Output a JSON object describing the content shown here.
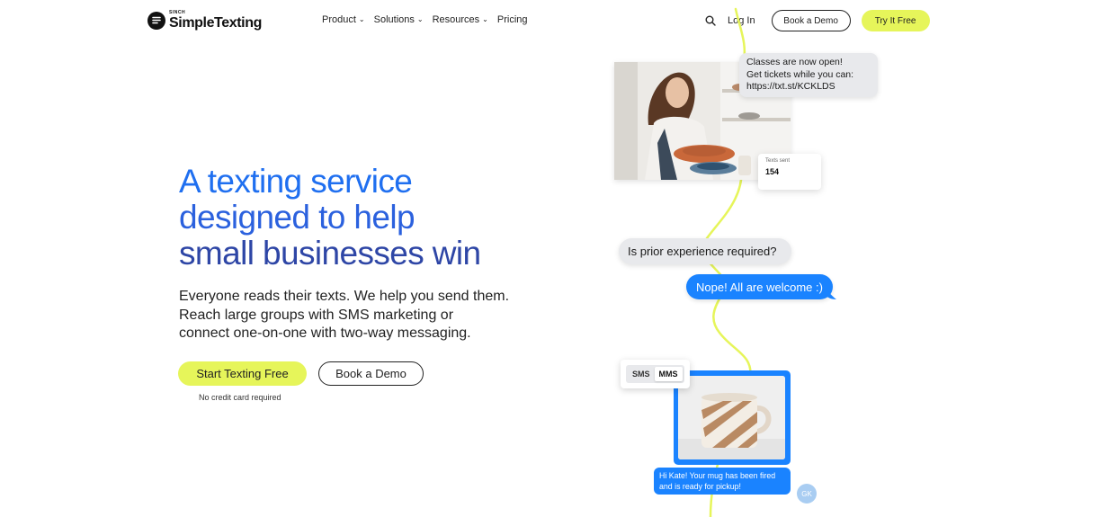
{
  "brand": {
    "sub": "SINCH",
    "name": "SimpleTexting"
  },
  "nav": {
    "items": [
      {
        "label": "Product",
        "has_dropdown": true
      },
      {
        "label": "Solutions",
        "has_dropdown": true
      },
      {
        "label": "Resources",
        "has_dropdown": true
      },
      {
        "label": "Pricing",
        "has_dropdown": false
      }
    ],
    "dropdown_glyph": "⌄",
    "login": "Log In",
    "book_demo": "Book a Demo",
    "try_free": "Try It Free"
  },
  "hero": {
    "headline": [
      "A texting service",
      "designed to help",
      "small businesses win"
    ],
    "subhead": [
      "Everyone reads their texts. We help you send them.",
      "Reach large groups with SMS marketing or",
      "connect one-on-one with two-way messaging."
    ],
    "cta_primary": "Start Texting Free",
    "cta_secondary": "Book a Demo",
    "note": "No credit card required"
  },
  "illustration": {
    "message_1": [
      "Classes are now open!",
      "Get tickets while you can:",
      "https://txt.st/KCKLDS"
    ],
    "stat_label": "Texts sent",
    "stat_value": "154",
    "question": "Is prior experience required?",
    "answer": "Nope! All are welcome :)",
    "toggle": {
      "options": [
        "SMS",
        "MMS"
      ],
      "selected": "MMS"
    },
    "reply": [
      "Hi Kate! Your mug has been fired",
      "and is ready for pickup!"
    ],
    "avatar_initials": "GK"
  },
  "colors": {
    "accent_lime": "#e6f55a",
    "headline_blue": "#1f6ff0",
    "headline_navy": "#2e46a6",
    "bubble_blue": "#1a83ff",
    "bubble_gray": "#e8e9ec"
  },
  "icons": [
    "logo-icon",
    "search-icon",
    "chevron-down-icon"
  ]
}
